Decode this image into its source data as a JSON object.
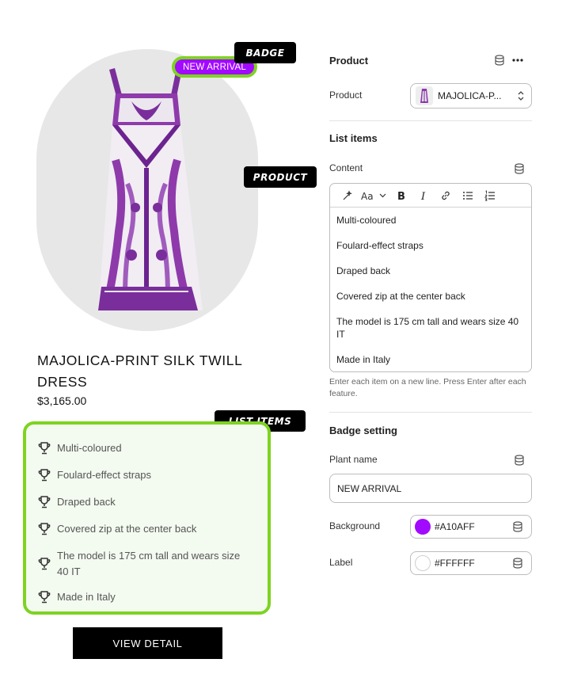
{
  "product_card": {
    "badge": "NEW ARRIVAL",
    "title": "MAJOLICA-PRINT SILK TWILL DRESS",
    "price": "$3,165.00",
    "features": [
      "Multi-coloured",
      "Foulard-effect straps",
      "Draped back",
      "Covered zip at the center back",
      "The model is 175 cm tall and wears size 40 IT",
      "Made in Italy"
    ],
    "feature_icon": "trophy-icon",
    "cta": "VIEW DETAIL"
  },
  "annotations": {
    "badge": "BADGE",
    "product": "PRODUCT",
    "list_items": "LIST ITEMS"
  },
  "panel": {
    "section_product": {
      "title": "Product",
      "product_label": "Product",
      "product_value": "MAJOLICA-P..."
    },
    "section_list": {
      "title": "List items",
      "content_label": "Content",
      "toolbar": [
        "magic-icon",
        "font-size-icon",
        "chevron-down-icon",
        "bold-icon",
        "italic-icon",
        "link-icon",
        "bullet-list-icon",
        "numbered-list-icon"
      ],
      "lines": [
        "Multi-coloured",
        "Foulard-effect straps",
        "Draped back",
        "Covered zip at the center back",
        "The model is 175 cm tall and wears size 40 IT",
        "Made in Italy"
      ],
      "help": "Enter each item on a new line. Press Enter after each feature."
    },
    "section_badge": {
      "title": "Badge setting",
      "plant_label": "Plant name",
      "plant_value": "NEW ARRIVAL",
      "bg_label": "Background",
      "bg_value": "#A10AFF",
      "label_label": "Label",
      "label_value": "#FFFFFF"
    }
  },
  "colors": {
    "badge_bg": "#A10AFF",
    "badge_text": "#FFFFFF",
    "highlight": "#7ED321",
    "feature_bg": "#F3FAEF"
  }
}
